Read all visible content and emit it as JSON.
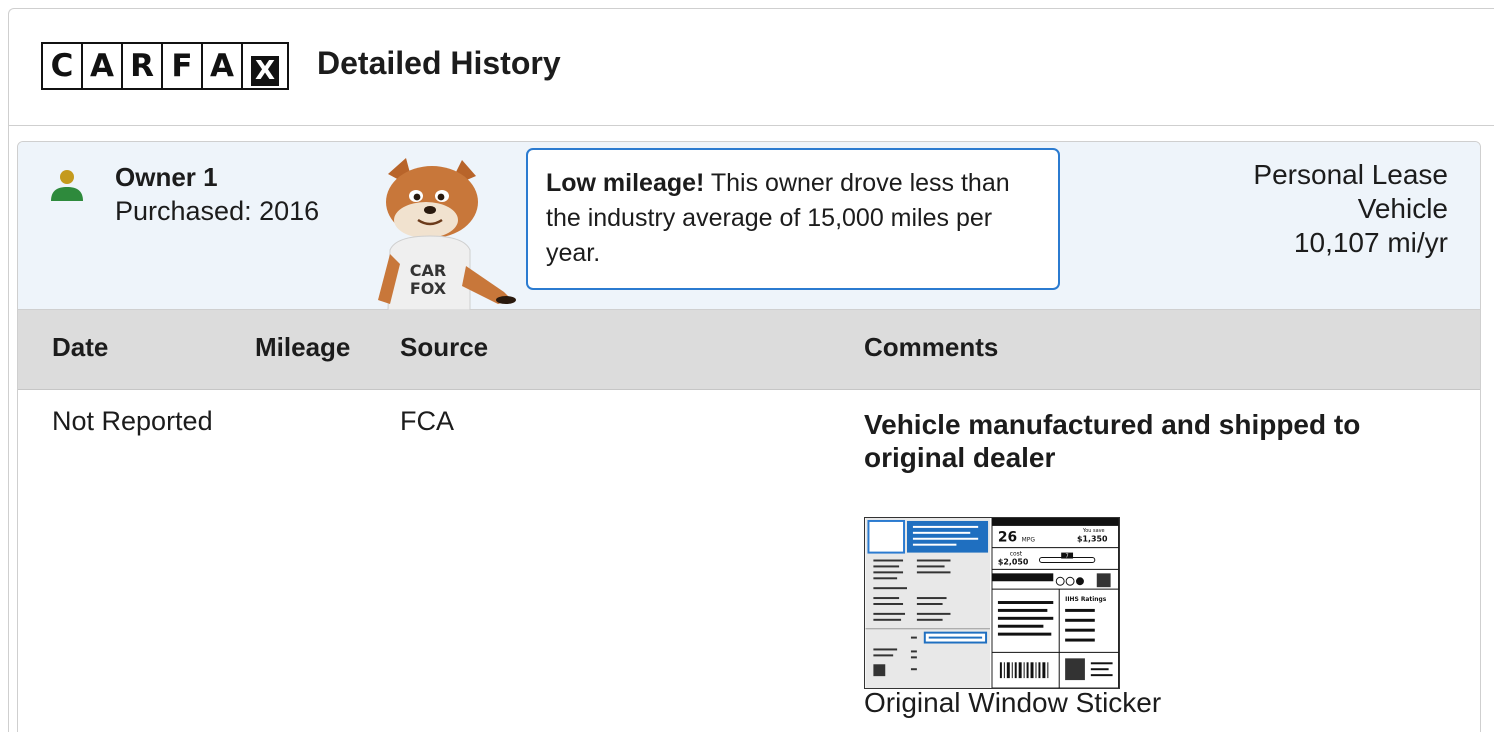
{
  "header": {
    "logo_letters": [
      "C",
      "A",
      "R",
      "F",
      "A",
      "X"
    ],
    "title": "Detailed History"
  },
  "owner": {
    "name": "Owner 1",
    "purchased": "Purchased: 2016",
    "mascot_shirt": "CAR FOX",
    "callout_bold": "Low mileage!",
    "callout_text": " This owner drove less than the industry average of 15,000 miles per year.",
    "ownership_type_1": "Personal Lease",
    "ownership_type_2": "Vehicle",
    "miles_per_year": "10,107 mi/yr"
  },
  "table": {
    "columns": [
      "Date",
      "Mileage",
      "Source",
      "Comments"
    ],
    "rows": [
      {
        "date": "Not Reported",
        "mileage": "",
        "source": "FCA",
        "comment_title": "Vehicle manufactured and shipped to original dealer",
        "sticker_caption": "Original Window Sticker"
      }
    ]
  },
  "sticker": {
    "mpg": "26",
    "mpg_unit": "MPG",
    "you_save_label": "You save",
    "you_save": "$1,350",
    "fuel_cost_label": "cost",
    "fuel_cost": "$2,050",
    "rating": "7",
    "ratings_title": "IIHS Ratings"
  },
  "colors": {
    "accent_blue": "#2b7bd0",
    "owner_band": "#eef4fa",
    "table_header": "#dcdcdc",
    "person_head": "#c49a1d",
    "person_body": "#2e8a3c"
  }
}
